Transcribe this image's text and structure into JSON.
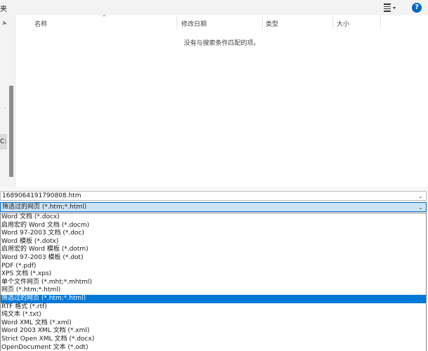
{
  "window": {
    "title_fragment": "夹"
  },
  "toolbar": {
    "view_icon": "list-view-icon",
    "help_label": "?"
  },
  "sidebar": {
    "drive_label": "C:)"
  },
  "file_list": {
    "columns": [
      "名称",
      "修改日期",
      "类型",
      "大小"
    ],
    "empty_message": "没有与搜索条件匹配的项。"
  },
  "filename": {
    "value": "1689064191790808.htm"
  },
  "save_type": {
    "selected": "筛选过的网页 (*.htm;*.html)",
    "options": [
      "Word 文档 (*.docx)",
      "启用宏的 Word 文档 (*.docm)",
      "Word 97-2003 文档 (*.doc)",
      "Word 模板 (*.dotx)",
      "启用宏的 Word 模板 (*.dotm)",
      "Word 97-2003 模板 (*.dot)",
      "PDF (*.pdf)",
      "XPS 文档 (*.xps)",
      "单个文件网页 (*.mht;*.mhtml)",
      "网页 (*.htm;*.html)",
      "筛选过的网页 (*.htm;*.html)",
      "RTF 格式 (*.rtf)",
      "纯文本 (*.txt)",
      "Word XML 文档 (*.xml)",
      "Word 2003 XML 文档 (*.xml)",
      "Strict Open XML 文档 (*.docx)",
      "OpenDocument 文本 (*.odt)"
    ],
    "selected_index": 10
  }
}
